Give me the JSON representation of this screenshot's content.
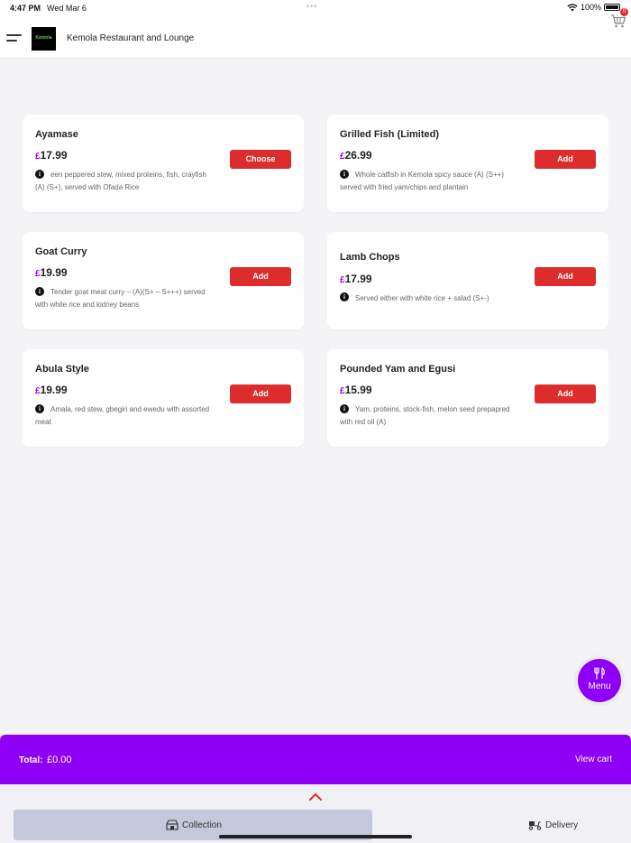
{
  "status_bar": {
    "time": "4:47 PM",
    "date": "Wed Mar 6",
    "battery": "100%"
  },
  "header": {
    "logo_text": "Kemola",
    "title": "Kemola Restaurant and Lounge",
    "cart_count": "0"
  },
  "items": [
    {
      "name": "Ayamase",
      "currency": "£",
      "price": "17.99",
      "description": "een peppered stew, mixed proteins, fish, crayfish (A) (S+), served with Ofada Rice",
      "button": "Choose"
    },
    {
      "name": "Grilled Fish (Limited)",
      "currency": "£",
      "price": "26.99",
      "description": "Whole catfish in Kemola spicy sauce (A) (S++) served with fried yam/chips and plantain",
      "button": "Add"
    },
    {
      "name": "Goat Curry",
      "currency": "£",
      "price": "19.99",
      "description": "Tender goat meat curry – (A)(S+ – S+++) served with white rice and kidney beans",
      "button": "Add"
    },
    {
      "name": "Lamb Chops",
      "currency": "£",
      "price": "17.99",
      "description": "Served either with white rice + salad (S+-)",
      "button": "Add"
    },
    {
      "name": "Abula Style",
      "currency": "£",
      "price": "19.99",
      "description": "Amala, red stew, gbegiri and ewedu with assorted meat",
      "button": "Add"
    },
    {
      "name": "Pounded Yam and Egusi",
      "currency": "£",
      "price": "15.99",
      "description": "Yam, proteins, stock-fish, melon seed prepapred with red oil (A)",
      "button": "Add"
    }
  ],
  "menu_fab": {
    "label": "Menu",
    "icon": "fork-knife-icon"
  },
  "cart_bar": {
    "total_label": "Total:",
    "total_value": "£0.00",
    "view_cart": "View cart"
  },
  "order_modes": {
    "collection": "Collection",
    "delivery": "Delivery",
    "selected": "Collection"
  },
  "colors": {
    "accent": "#8e00f5",
    "button_red": "#dc2c2c",
    "background": "#f4f4f6"
  }
}
